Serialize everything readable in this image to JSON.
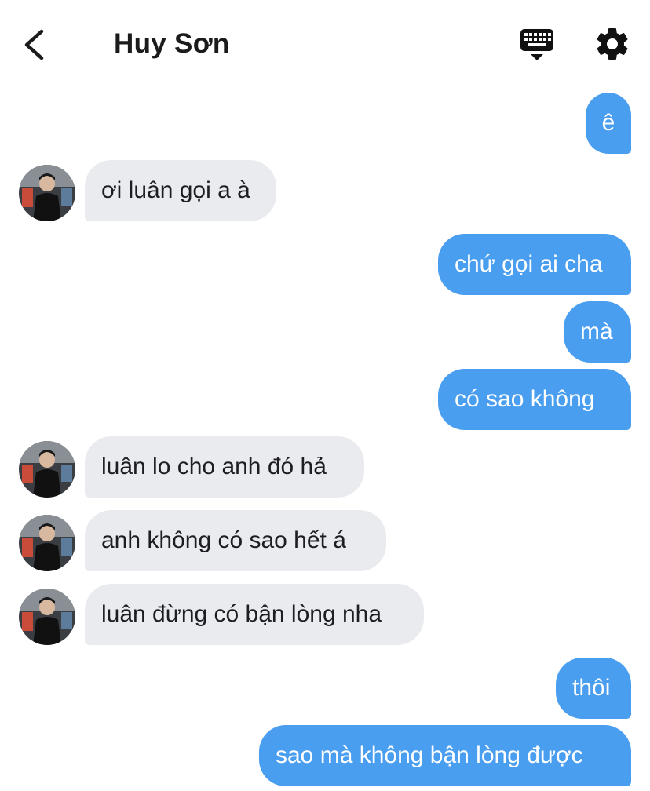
{
  "header": {
    "contact_name": "Huy Sơn",
    "back_icon": "chevron-left-icon",
    "keyboard_icon": "keyboard-icon",
    "settings_icon": "gear-icon"
  },
  "colors": {
    "outgoing_bubble": "#4a9ef0",
    "incoming_bubble": "#e9ebef",
    "outgoing_text": "#ffffff",
    "incoming_text": "#1e1e22"
  },
  "messages": [
    {
      "from": "me",
      "text": "ê"
    },
    {
      "from": "contact",
      "text": "ơi luân gọi a à"
    },
    {
      "from": "me",
      "text": "chứ gọi ai cha"
    },
    {
      "from": "me",
      "text": "mà"
    },
    {
      "from": "me",
      "text": "có sao không"
    },
    {
      "from": "contact",
      "text": "luân lo cho anh đó hả"
    },
    {
      "from": "contact",
      "text": "anh không có sao hết á"
    },
    {
      "from": "contact",
      "text": "luân đừng có bận lòng nha"
    },
    {
      "from": "me",
      "text": "thôi"
    },
    {
      "from": "me",
      "text": "sao mà không bận lòng được"
    }
  ]
}
